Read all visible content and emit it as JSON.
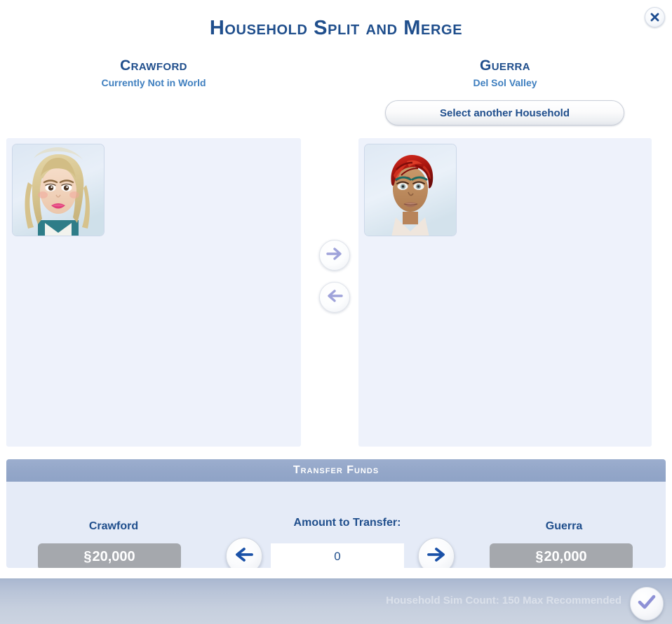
{
  "dialog": {
    "title": "Household Split and Merge",
    "close_icon": "close-x-icon"
  },
  "households": {
    "left": {
      "name": "Crawford",
      "status": "Currently Not in World",
      "sims": [
        {
          "label": "Sim portrait: blonde hair, light skin"
        }
      ]
    },
    "right": {
      "name": "Guerra",
      "status": "Del Sol Valley",
      "select_button": "Select another Household",
      "sims": [
        {
          "label": "Sim portrait: short red curly hair, dark skin"
        }
      ]
    }
  },
  "transfer_arrows": {
    "right_icon": "arrow-right-icon",
    "left_icon": "arrow-left-icon"
  },
  "funds": {
    "header": "Transfer Funds",
    "left_label": "Crawford",
    "left_amount": "20,000",
    "right_label": "Guerra",
    "right_amount": "20,000",
    "currency_symbol": "§",
    "amount_label": "Amount to Transfer:",
    "amount_value": "0",
    "amount_placeholder": "0",
    "decrease_icon": "arrow-left-icon",
    "increase_icon": "arrow-right-icon"
  },
  "bottom": {
    "hint": "Household Sim Count: 150 Max Recommended",
    "accept_icon": "checkmark-icon"
  },
  "colors": {
    "title_blue": "#1f4e8c",
    "subtitle_blue": "#3f7fbf",
    "panel_bg": "#eef2fb",
    "funds_header": "#94a7c9",
    "amount_chip": "#a5a8ad",
    "arrow_active": "#1a51a8",
    "arrow_disabled": "#9fa3da",
    "bottom_bar": "#c0cada"
  }
}
